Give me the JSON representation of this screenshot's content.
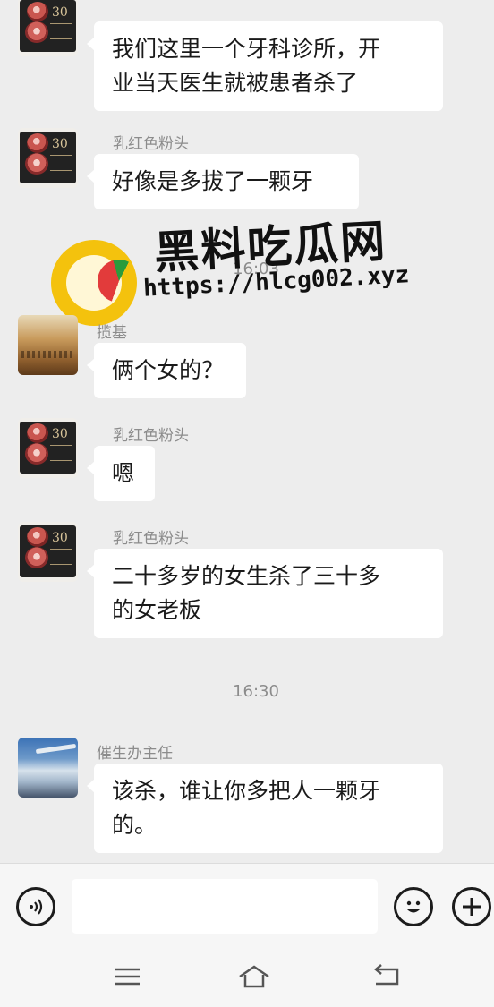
{
  "messages": [
    {
      "sender": "",
      "text_lines": [
        "我们这里一个牙科诊所，开",
        "业当天医生就被患者杀了"
      ]
    },
    {
      "sender": "乳红色粉头",
      "text_lines": [
        "好像是多拔了一颗牙"
      ]
    },
    {
      "sender": "揽基",
      "text_lines": [
        "俩个女的？"
      ]
    },
    {
      "sender": "乳红色粉头",
      "text_lines": [
        "嗯"
      ]
    },
    {
      "sender": "乳红色粉头",
      "text_lines": [
        "二十多岁的女生杀了三十多",
        "的女老板"
      ]
    },
    {
      "sender": "催生办主任",
      "text_lines": [
        "该杀，谁让你多把人一颗牙",
        "的。"
      ]
    }
  ],
  "timestamps": [
    "16:03",
    "16:30"
  ],
  "avatar_text": {
    "cake_number": "30"
  },
  "watermark": {
    "title": "黑料吃瓜网",
    "url": "https://hlcg002.xyz"
  },
  "input": {
    "placeholder": ""
  },
  "icons": {
    "voice": "voice-icon",
    "emoji": "emoji-icon",
    "plus": "plus-icon",
    "menu": "menu-icon",
    "home": "home-icon",
    "back": "back-icon"
  },
  "colors": {
    "background": "#ededed",
    "bubble": "#ffffff",
    "secondary_text": "#8c8c8c"
  }
}
